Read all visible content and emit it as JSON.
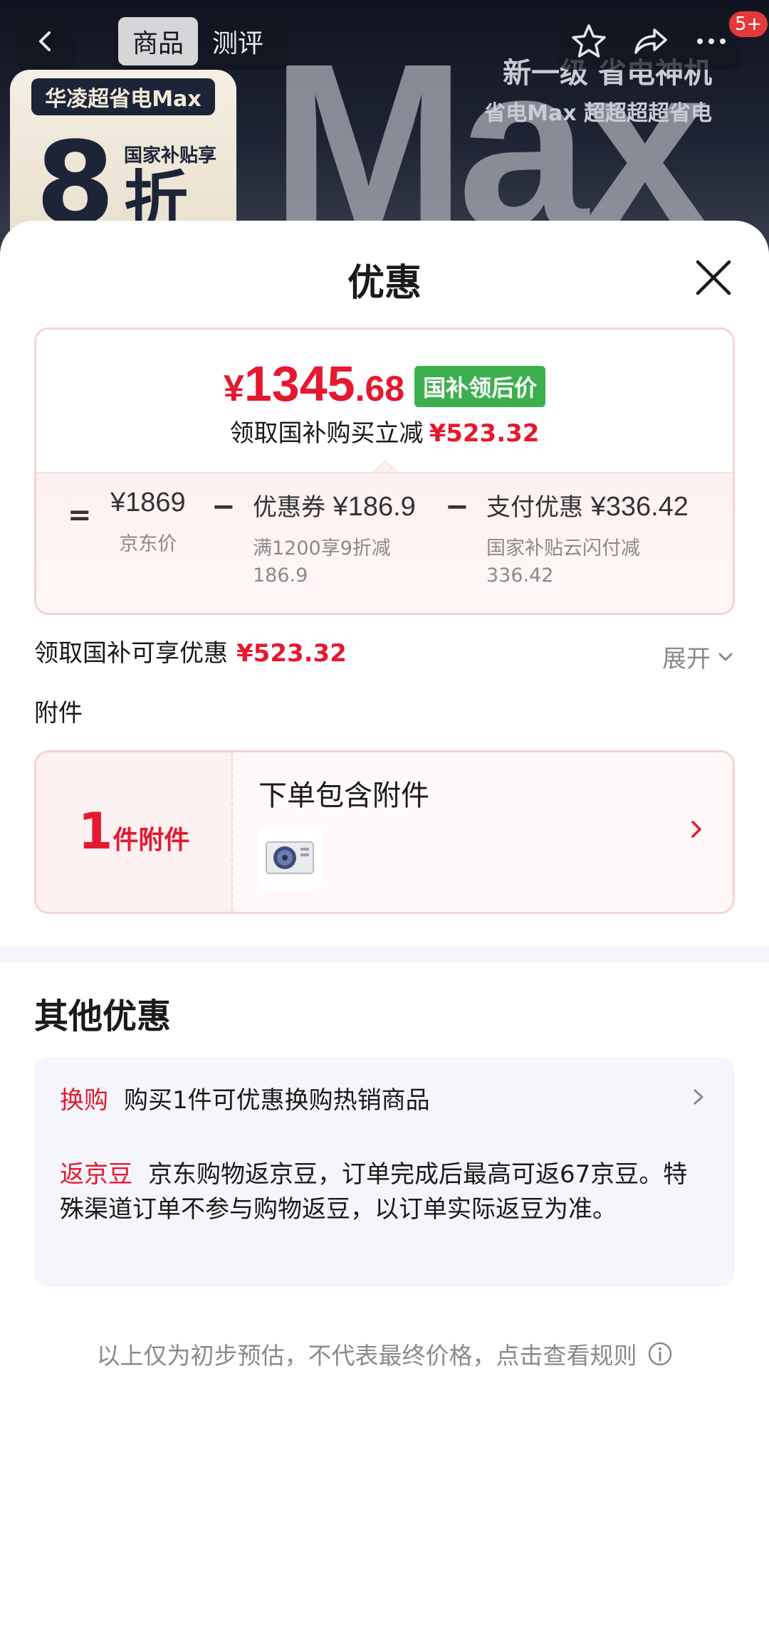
{
  "header": {
    "tabs": [
      {
        "label": "商品",
        "active": true
      },
      {
        "label": "测评",
        "active": false
      }
    ],
    "cart_badge": "5+",
    "hero": {
      "brand_tag": "华凌超省电Max",
      "subsidy_text": "国家补贴享",
      "discount_num": "8",
      "discount_unit": "折",
      "big_text": "Max",
      "slogan_1": "新一级 省电神机",
      "slogan_2": "省电Max 超超超超省电"
    }
  },
  "sheet": {
    "title": "优惠",
    "price": {
      "currency": "¥",
      "integer": "1345",
      "decimal": ".68",
      "tag": "国补领后价",
      "save_label": "领取国补购买立减",
      "save_amount": "¥523.32"
    },
    "breakdown": {
      "eq": "=",
      "minus": "−",
      "items": [
        {
          "label": "",
          "value": "¥1869",
          "sub": "京东价"
        },
        {
          "label": "优惠券",
          "value": "¥186.9",
          "sub": "满1200享9折减\n186.9"
        },
        {
          "label": "支付优惠",
          "value": "¥336.42",
          "sub": "国家补贴云闪付减\n336.42"
        }
      ]
    },
    "promo": {
      "label": "领取国补可享优惠",
      "amount": "¥523.32",
      "expand": "展开"
    },
    "attachment": {
      "section_label": "附件",
      "count": "1",
      "count_unit": "件附件",
      "title": "下单包含附件"
    },
    "other": {
      "title": "其他优惠",
      "rows": [
        {
          "tag": "换购",
          "text": "购买1件可优惠换购热销商品"
        },
        {
          "tag": "返京豆",
          "text": "京东购物返京豆，订单完成后最高可返67京豆。特殊渠道订单不参与购物返豆，以订单实际返豆为准。"
        }
      ]
    },
    "footnote": "以上仅为初步预估，不代表最终价格，点击查看规则"
  },
  "colors": {
    "accent_red": "#e4192f",
    "tag_green": "#3db04e",
    "card_border": "#f6d2d6"
  },
  "icons": [
    "back-icon",
    "star-icon",
    "share-icon",
    "more-icon",
    "close-icon",
    "chevron-down-icon",
    "chevron-right-icon",
    "info-icon",
    "air-conditioner-icon"
  ]
}
